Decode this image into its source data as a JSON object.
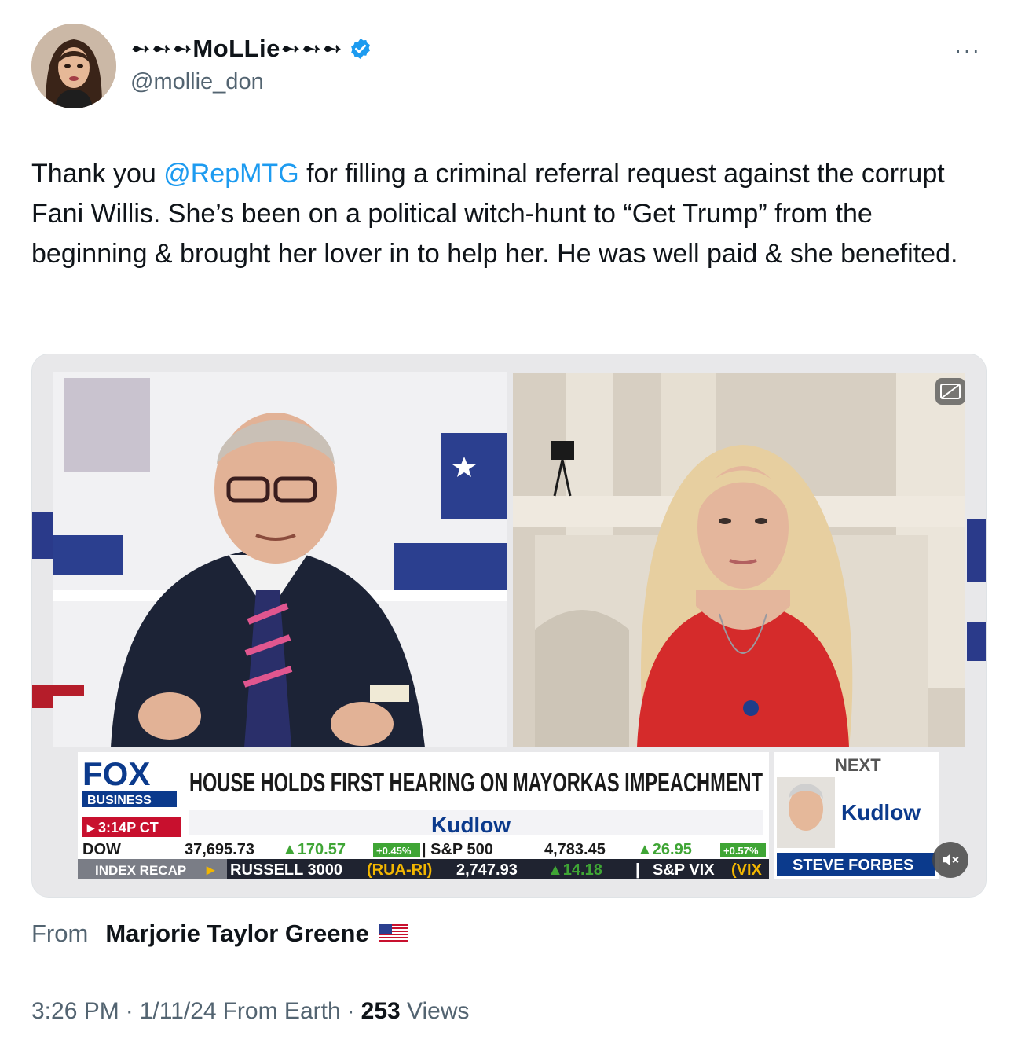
{
  "author": {
    "display_name": "➻➻➻MoLLie➻➻➻",
    "handle": "@mollie_don"
  },
  "more_label": "···",
  "tweet": {
    "prefix": "Thank you ",
    "mention": "@RepMTG",
    "body": " for filling a criminal referral request against the corrupt Fani Willis. She’s been on a political witch-hunt to “Get Trump” from the beginning & brought her lover in to help her. He was well paid & she benefited."
  },
  "video": {
    "logo_main": "FOX",
    "logo_sub": "BUSINESS",
    "time": "▸ 3:14P CT",
    "headline": "HOUSE HOLDS FIRST HEARING ON MAYORKAS IMPEACHMENT",
    "show": "Kudlow",
    "next_label": "NEXT",
    "next_show": "Kudlow",
    "next_guest": "STEVE FORBES",
    "ticker1": [
      "DOW",
      "37,695.73",
      "▲170.57",
      "+0.45%",
      "| S&P 500",
      "4,783.45",
      "▲26.95",
      "+0.57%"
    ],
    "ticker2": [
      "INDEX RECAP",
      "▸",
      "RUSSELL 3000",
      "(RUA-RI)",
      "2,747.93",
      "▲14.18",
      "|",
      "S&P VIX",
      "(VIX"
    ],
    "colors": {
      "fox_blue": "#0b3a8c",
      "banner_red": "#c8102e",
      "ticker_green": "#3fa535",
      "dress_red": "#d52b2b",
      "suit_navy": "#1c2336"
    }
  },
  "source": {
    "from_label": "From",
    "name": "Marjorie Taylor Greene"
  },
  "meta": {
    "time": "3:26 PM",
    "sep1": "·",
    "date": "1/11/24",
    "location": "From Earth",
    "sep2": "·",
    "views_count": "253",
    "views_label": "Views"
  }
}
